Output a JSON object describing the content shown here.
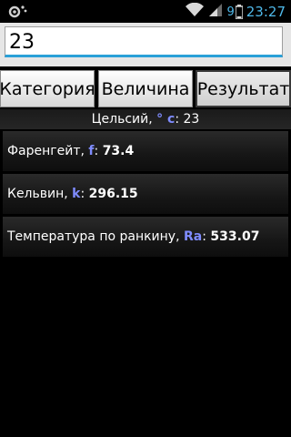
{
  "status_bar": {
    "clock": "23:27",
    "battery_level": "9",
    "signal_icon": "signal-icon",
    "wifi_icon": "wifi-icon",
    "notification_icon": "notification-icon"
  },
  "input": {
    "value": "23"
  },
  "tabs": [
    {
      "label": "Категория"
    },
    {
      "label": "Величина"
    },
    {
      "label": "Результат"
    }
  ],
  "header": {
    "prefix": "Цельсий, ",
    "symbol": "° c",
    "separator": ": ",
    "value": "23"
  },
  "results": [
    {
      "name": "Фаренгейт, ",
      "symbol": "f",
      "value": "73.4"
    },
    {
      "name": "Кельвин, ",
      "symbol": "k",
      "value": "296.15"
    },
    {
      "name": "Температура по ранкину, ",
      "symbol": "Ra",
      "value": "533.07"
    }
  ],
  "colors": {
    "accent": "#2aa0d8",
    "symbol": "#7f8cff",
    "clock": "#4fb8e8"
  }
}
